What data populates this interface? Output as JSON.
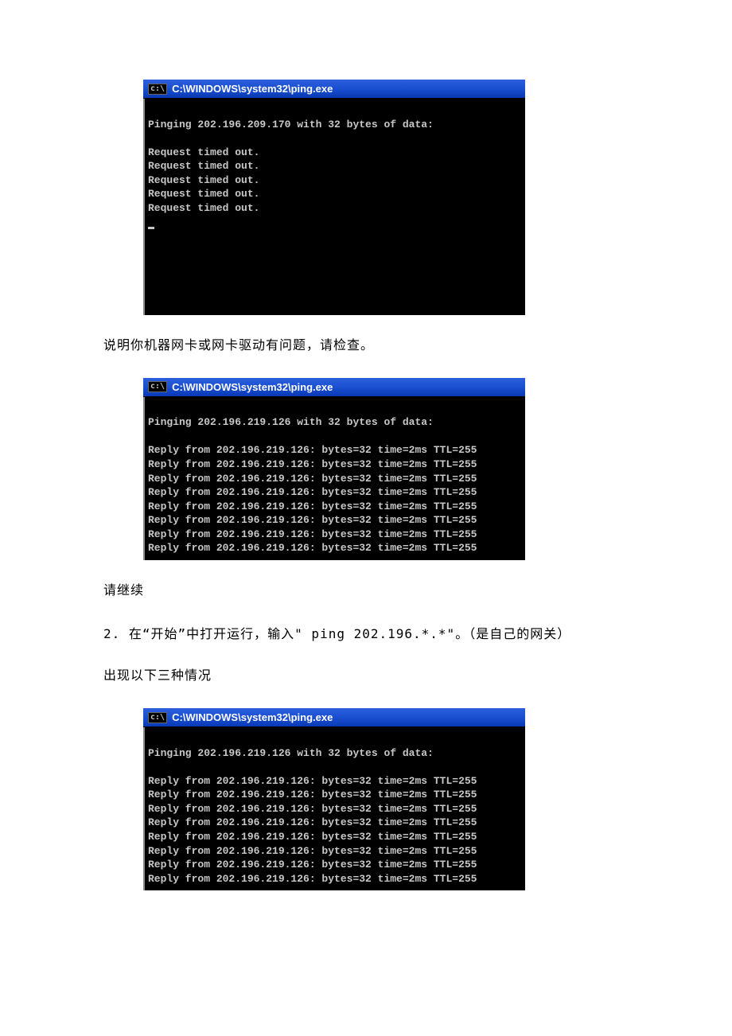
{
  "windows": [
    {
      "title": "C:\\WINDOWS\\system32\\ping.exe",
      "lines": [
        "",
        "Pinging 202.196.209.170 with 32 bytes of data:",
        "",
        "Request timed out.",
        "Request timed out.",
        "Request timed out.",
        "Request timed out.",
        "Request timed out.",
        ""
      ]
    },
    {
      "title": "C:\\WINDOWS\\system32\\ping.exe",
      "lines": [
        "",
        "Pinging 202.196.219.126 with 32 bytes of data:",
        "",
        "Reply from 202.196.219.126: bytes=32 time=2ms TTL=255",
        "Reply from 202.196.219.126: bytes=32 time=2ms TTL=255",
        "Reply from 202.196.219.126: bytes=32 time=2ms TTL=255",
        "Reply from 202.196.219.126: bytes=32 time=2ms TTL=255",
        "Reply from 202.196.219.126: bytes=32 time=2ms TTL=255",
        "Reply from 202.196.219.126: bytes=32 time=2ms TTL=255",
        "Reply from 202.196.219.126: bytes=32 time=2ms TTL=255",
        "Reply from 202.196.219.126: bytes=32 time=2ms TTL=255"
      ]
    },
    {
      "title": "C:\\WINDOWS\\system32\\ping.exe",
      "lines": [
        "",
        "Pinging 202.196.219.126 with 32 bytes of data:",
        "",
        "Reply from 202.196.219.126: bytes=32 time=2ms TTL=255",
        "Reply from 202.196.219.126: bytes=32 time=2ms TTL=255",
        "Reply from 202.196.219.126: bytes=32 time=2ms TTL=255",
        "Reply from 202.196.219.126: bytes=32 time=2ms TTL=255",
        "Reply from 202.196.219.126: bytes=32 time=2ms TTL=255",
        "Reply from 202.196.219.126: bytes=32 time=2ms TTL=255",
        "Reply from 202.196.219.126: bytes=32 time=2ms TTL=255",
        "Reply from 202.196.219.126: bytes=32 time=2ms TTL=255"
      ]
    }
  ],
  "text": {
    "p1": "说明你机器网卡或网卡驱动有问题，请检查。",
    "p2": "请继续",
    "step2": "2. 在“开始”中打开运行，输入\" ping 202.196.*.*\"。（是自己的网关）",
    "p3": "出现以下三种情况"
  },
  "icon_label": "cmd-icon"
}
